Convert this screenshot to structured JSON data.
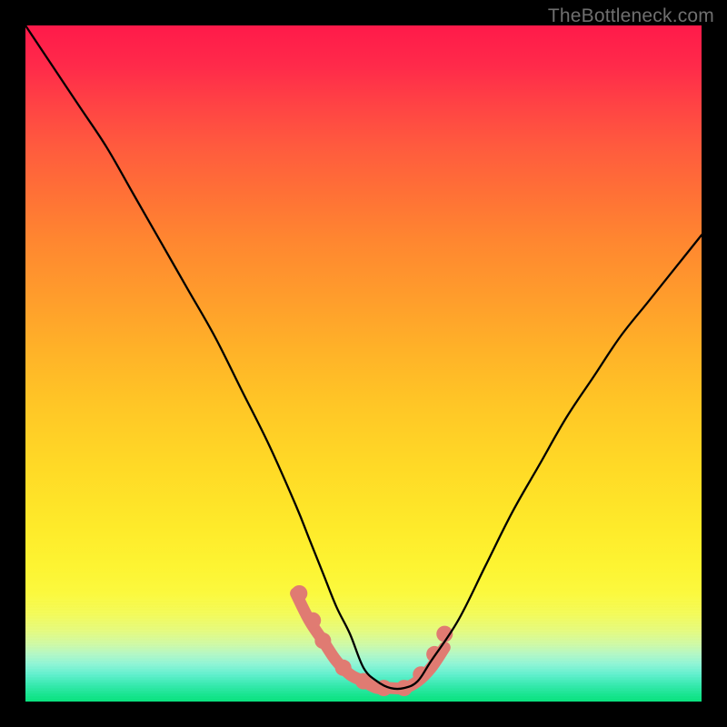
{
  "watermark": "TheBottleneck.com",
  "chart_data": {
    "type": "line",
    "title": "",
    "xlabel": "",
    "ylabel": "",
    "xlim": [
      0,
      100
    ],
    "ylim": [
      0,
      100
    ],
    "grid": false,
    "legend": false,
    "background": {
      "type": "vertical-gradient",
      "stops": [
        {
          "pos": 0.0,
          "color": "#ff1a4a"
        },
        {
          "pos": 0.25,
          "color": "#ff7136"
        },
        {
          "pos": 0.5,
          "color": "#ffbb27"
        },
        {
          "pos": 0.75,
          "color": "#fdf22d"
        },
        {
          "pos": 0.9,
          "color": "#ddfb8a"
        },
        {
          "pos": 1.0,
          "color": "#09e37e"
        }
      ]
    },
    "series": [
      {
        "name": "bottleneck-curve",
        "color": "#000000",
        "x": [
          0,
          4,
          8,
          12,
          16,
          20,
          24,
          28,
          32,
          36,
          40,
          42,
          44,
          46,
          48,
          50,
          52,
          54,
          56,
          58,
          60,
          64,
          68,
          72,
          76,
          80,
          84,
          88,
          92,
          96,
          100
        ],
        "y": [
          100,
          94,
          88,
          82,
          75,
          68,
          61,
          54,
          46,
          38,
          29,
          24,
          19,
          14,
          10,
          5,
          3,
          2,
          2,
          3,
          6,
          12,
          20,
          28,
          35,
          42,
          48,
          54,
          59,
          64,
          69
        ]
      }
    ],
    "highlight_segment": {
      "name": "optimal-range",
      "color": "#e07b72",
      "thickness": 13,
      "x": [
        40,
        42,
        44,
        46,
        48,
        50,
        52,
        54,
        56,
        58,
        60,
        62
      ],
      "y": [
        16,
        12,
        9,
        6,
        4,
        3,
        2,
        2,
        2,
        3,
        5,
        8
      ]
    },
    "markers": {
      "name": "highlight-dots",
      "color": "#e07b72",
      "radius": 9,
      "points": [
        {
          "x": 40.5,
          "y": 16
        },
        {
          "x": 42.5,
          "y": 12
        },
        {
          "x": 44.0,
          "y": 9
        },
        {
          "x": 47.0,
          "y": 5
        },
        {
          "x": 50.0,
          "y": 3
        },
        {
          "x": 53.0,
          "y": 2
        },
        {
          "x": 56.0,
          "y": 2
        },
        {
          "x": 58.5,
          "y": 4
        },
        {
          "x": 60.5,
          "y": 7
        },
        {
          "x": 62.0,
          "y": 10
        }
      ]
    }
  }
}
